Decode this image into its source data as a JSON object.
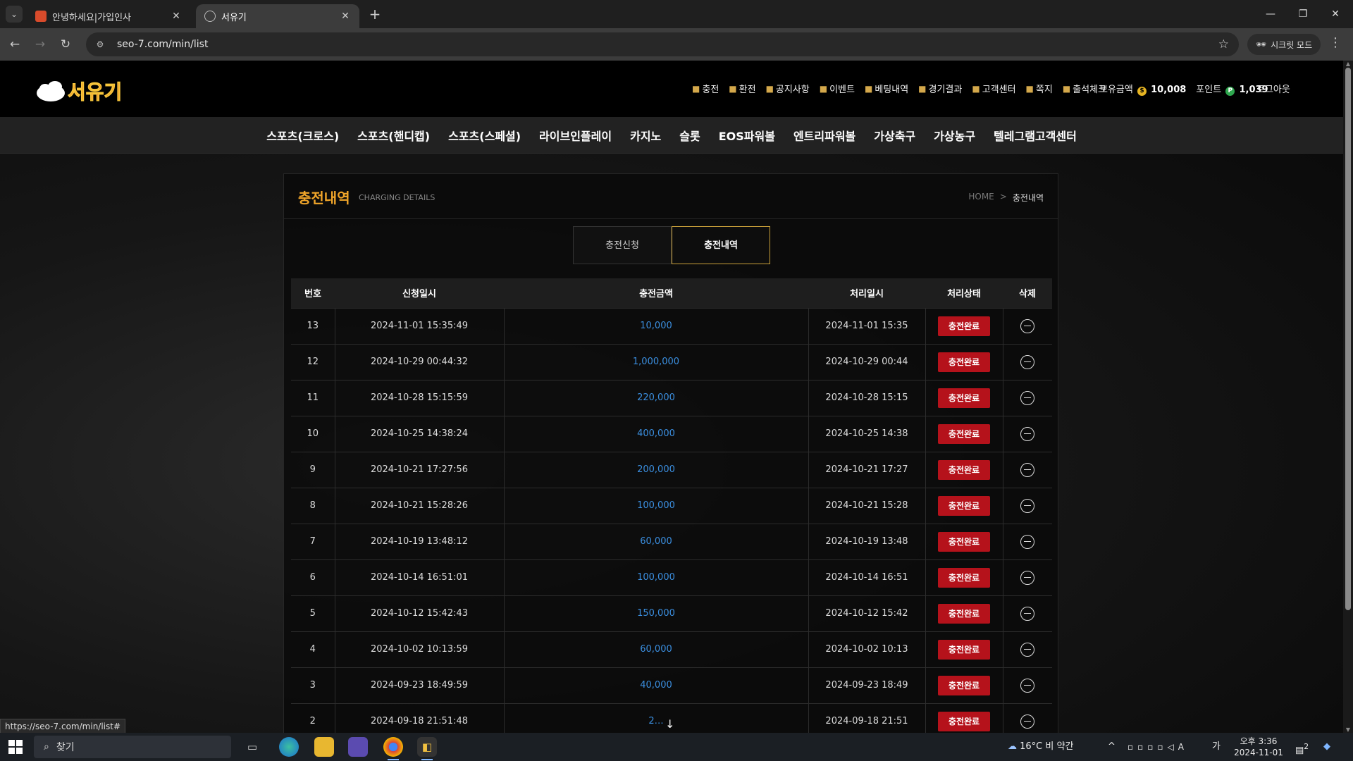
{
  "browser": {
    "tabs": [
      {
        "title": "안녕하세요|가입인사",
        "active": false
      },
      {
        "title": "서유기",
        "active": true
      }
    ],
    "url": "seo-7.com/min/list",
    "incognito_label": "시크릿 모드",
    "status_link": "https://seo-7.com/min/list#"
  },
  "site": {
    "logo_text": "서유기",
    "top_nav": [
      {
        "label": "충전",
        "icon": "wallet-icon"
      },
      {
        "label": "환전",
        "icon": "exchange-icon"
      },
      {
        "label": "공지사항",
        "icon": "megaphone-icon"
      },
      {
        "label": "이벤트",
        "icon": "gift-icon"
      },
      {
        "label": "베팅내역",
        "icon": "receipt-icon"
      },
      {
        "label": "경기결과",
        "icon": "check-doc-icon"
      },
      {
        "label": "고객센터",
        "icon": "support-icon"
      },
      {
        "label": "쪽지",
        "icon": "message-icon"
      },
      {
        "label": "출석체크",
        "icon": "calendar-check-icon"
      }
    ],
    "balance_label": "보유금액",
    "balance_value": "10,008",
    "point_label": "포인트",
    "point_value": "1,039",
    "logout_label": "로그아웃",
    "main_nav": [
      "스포츠(크로스)",
      "스포츠(핸디캡)",
      "스포츠(스페셜)",
      "라이브인플레이",
      "카지노",
      "슬롯",
      "EOS파워볼",
      "엔트리파워볼",
      "가상축구",
      "가상농구",
      "텔레그램고객센터"
    ]
  },
  "page": {
    "title": "충전내역",
    "subtitle": "CHARGING DETAILS",
    "breadcrumb_home": "HOME",
    "breadcrumb_sep": ">",
    "breadcrumb_current": "충전내역",
    "tab_request": "충전신청",
    "tab_history": "충전내역"
  },
  "table": {
    "headers": {
      "no": "번호",
      "requested": "신청일시",
      "amount": "충전금액",
      "processed": "처리일시",
      "status": "처리상태",
      "delete": "삭제"
    },
    "rows": [
      {
        "no": "13",
        "requested": "2024-11-01 15:35:49",
        "amount": "10,000",
        "processed": "2024-11-01 15:35",
        "status": "충전완료"
      },
      {
        "no": "12",
        "requested": "2024-10-29 00:44:32",
        "amount": "1,000,000",
        "processed": "2024-10-29 00:44",
        "status": "충전완료"
      },
      {
        "no": "11",
        "requested": "2024-10-28 15:15:59",
        "amount": "220,000",
        "processed": "2024-10-28 15:15",
        "status": "충전완료"
      },
      {
        "no": "10",
        "requested": "2024-10-25 14:38:24",
        "amount": "400,000",
        "processed": "2024-10-25 14:38",
        "status": "충전완료"
      },
      {
        "no": "9",
        "requested": "2024-10-21 17:27:56",
        "amount": "200,000",
        "processed": "2024-10-21 17:27",
        "status": "충전완료"
      },
      {
        "no": "8",
        "requested": "2024-10-21 15:28:26",
        "amount": "100,000",
        "processed": "2024-10-21 15:28",
        "status": "충전완료"
      },
      {
        "no": "7",
        "requested": "2024-10-19 13:48:12",
        "amount": "60,000",
        "processed": "2024-10-19 13:48",
        "status": "충전완료"
      },
      {
        "no": "6",
        "requested": "2024-10-14 16:51:01",
        "amount": "100,000",
        "processed": "2024-10-14 16:51",
        "status": "충전완료"
      },
      {
        "no": "5",
        "requested": "2024-10-12 15:42:43",
        "amount": "150,000",
        "processed": "2024-10-12 15:42",
        "status": "충전완료"
      },
      {
        "no": "4",
        "requested": "2024-10-02 10:13:59",
        "amount": "60,000",
        "processed": "2024-10-02 10:13",
        "status": "충전완료"
      },
      {
        "no": "3",
        "requested": "2024-09-23 18:49:59",
        "amount": "40,000",
        "processed": "2024-09-23 18:49",
        "status": "충전완료"
      },
      {
        "no": "2",
        "requested": "2024-09-18 21:51:48",
        "amount": "2…",
        "processed": "2024-09-18 21:51",
        "status": "충전완료"
      }
    ]
  },
  "taskbar": {
    "search_placeholder": "찾기",
    "weather": "16°C  비 약간",
    "time": "오후 3:36",
    "date": "2024-11-01",
    "notification_count": "2"
  },
  "colors": {
    "accent": "#f0a52a",
    "amount": "#3b8fe0",
    "status_badge": "#b5121b",
    "active_tab_border": "#c9a03a"
  }
}
